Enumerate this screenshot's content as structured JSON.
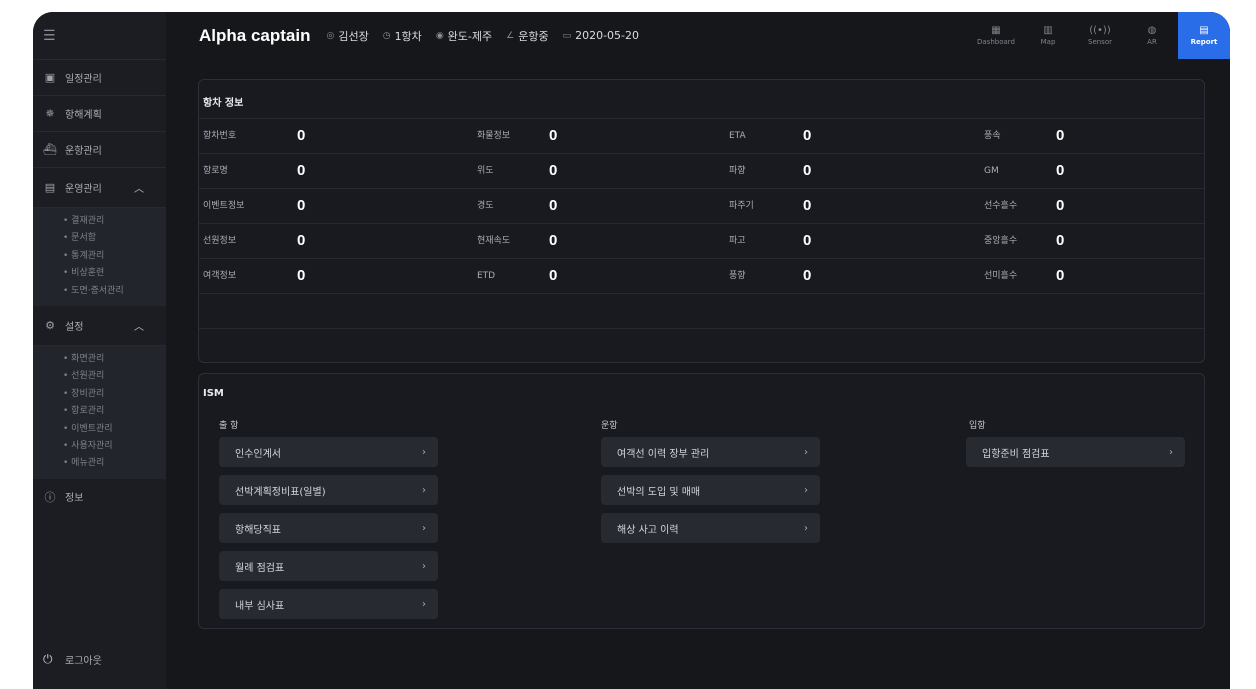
{
  "header": {
    "title": "Alpha captain",
    "captain": "김선장",
    "voyage": "1항차",
    "route": "완도-제주",
    "status": "운항중",
    "date": "2020-05-20",
    "nav": [
      {
        "label": "Dashboard",
        "icon": "dashboard-icon",
        "active": false
      },
      {
        "label": "Map",
        "icon": "map-icon",
        "active": false
      },
      {
        "label": "Sensor",
        "icon": "sensor-icon",
        "active": false
      },
      {
        "label": "AR",
        "icon": "ar-icon",
        "active": false
      },
      {
        "label": "Report",
        "icon": "report-icon",
        "active": true
      }
    ]
  },
  "sidebar": {
    "menu_icon": "menu-icon",
    "items": [
      {
        "label": "일정관리",
        "icon": "calendar-icon"
      },
      {
        "label": "항해계획",
        "icon": "helm-icon"
      },
      {
        "label": "운항관리",
        "icon": "ship-icon"
      },
      {
        "label": "운영관리",
        "icon": "operations-icon",
        "expanded": true
      }
    ],
    "ops_sub": [
      "결재관리",
      "문서함",
      "통계관리",
      "비상훈련",
      "도면·증서관리"
    ],
    "settings": {
      "label": "설정",
      "icon": "gear-icon"
    },
    "settings_sub": [
      "화면관리",
      "선원관리",
      "장비관리",
      "항로관리",
      "이벤트관리",
      "사용자관리",
      "메뉴관리"
    ],
    "info": {
      "label": "정보",
      "icon": "info-icon"
    },
    "logout": {
      "label": "로그아웃",
      "icon": "power-icon"
    }
  },
  "voyage_info": {
    "title": "항차 정보",
    "rows": [
      [
        {
          "label": "항차번호",
          "value": "0"
        },
        {
          "label": "화물정보",
          "value": "0"
        },
        {
          "label": "ETA",
          "value": "0"
        },
        {
          "label": "풍속",
          "value": "0"
        }
      ],
      [
        {
          "label": "항로명",
          "value": "0"
        },
        {
          "label": "위도",
          "value": "0"
        },
        {
          "label": "파향",
          "value": "0"
        },
        {
          "label": "GM",
          "value": "0"
        }
      ],
      [
        {
          "label": "이벤트정보",
          "value": "0"
        },
        {
          "label": "경도",
          "value": "0"
        },
        {
          "label": "파주기",
          "value": "0"
        },
        {
          "label": "선수흘수",
          "value": "0"
        }
      ],
      [
        {
          "label": "선원정보",
          "value": "0"
        },
        {
          "label": "현재속도",
          "value": "0"
        },
        {
          "label": "파고",
          "value": "0"
        },
        {
          "label": "중앙흘수",
          "value": "0"
        }
      ],
      [
        {
          "label": "여객정보",
          "value": "0"
        },
        {
          "label": "ETD",
          "value": "0"
        },
        {
          "label": "풍향",
          "value": "0"
        },
        {
          "label": "선미흘수",
          "value": "0"
        }
      ]
    ]
  },
  "ism": {
    "title": "ISM",
    "departure": {
      "label": "출 항",
      "items": [
        "인수인계서",
        "선박계획정비표(일별)",
        "항해당직표",
        "월례 점검표",
        "내부 심사표"
      ]
    },
    "operation": {
      "label": "운항",
      "items": [
        "여객선 이력 장부 관리",
        "선박의 도입 및 매매",
        "해상 사고 이력"
      ]
    },
    "arrival": {
      "label": "입항",
      "items": [
        "입항준비 점검표"
      ]
    }
  }
}
